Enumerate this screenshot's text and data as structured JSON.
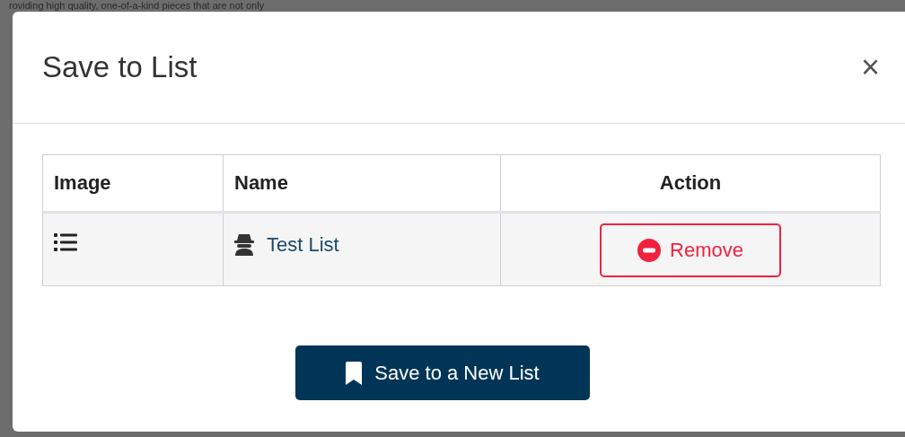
{
  "background": {
    "text": "roviding high quality, one-of-a-kind pieces that are not only"
  },
  "dialog": {
    "title": "Save to List",
    "close": "×"
  },
  "table": {
    "columns": [
      "Image",
      "Name",
      "Action"
    ],
    "rows": [
      {
        "name": "Test List",
        "action": "Remove"
      }
    ]
  },
  "footer_button": "Save to a New List"
}
